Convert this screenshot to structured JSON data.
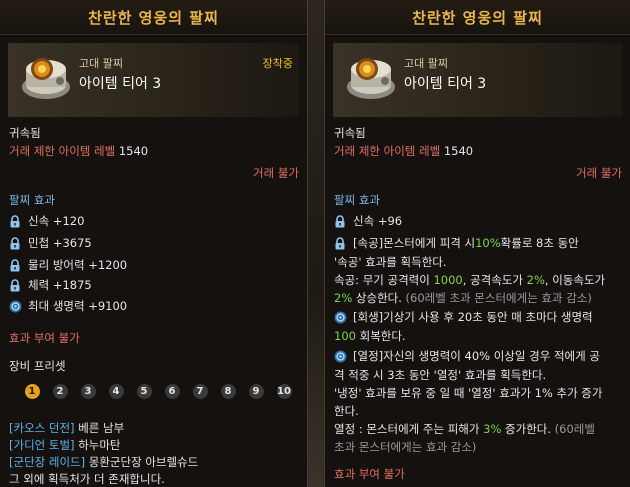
{
  "left": {
    "title": "찬란한 영웅의 팔찌",
    "grade": "고대 팔찌",
    "tier": "아이템 티어 3",
    "equipped": "장착중",
    "bound": "귀속됨",
    "level_limit_label": "거래 제한 아이템 레벨",
    "level_limit_value": "1540",
    "trade": "거래 불가",
    "effects_title": "팔찌 효과",
    "stats": [
      {
        "label": "신속 +120",
        "icon": "lock-icon"
      },
      {
        "label": "민첩 +3675",
        "icon": "lock-icon"
      },
      {
        "label": "물리 방어력 +1200",
        "icon": "lock-icon"
      },
      {
        "label": "체력 +1875",
        "icon": "lock-icon"
      },
      {
        "label": "최대 생명력 +9100",
        "icon": "swirl-icon"
      }
    ],
    "effect_grant": "효과 부여 불가",
    "preset_title": "장비 프리셋",
    "presets": [
      "1",
      "2",
      "3",
      "4",
      "5",
      "6",
      "7",
      "8",
      "9",
      "10"
    ],
    "active_preset": "1",
    "sources": [
      {
        "tag": "[카오스 던전]",
        "name": "베른 남부"
      },
      {
        "tag": "[가디언 토벌]",
        "name": "하누마탄"
      },
      {
        "tag": "[군단장 레이드]",
        "name": "몽환군단장 아브렐슈드"
      }
    ],
    "more_sources": "그 외에 획득처가 더 존재합니다."
  },
  "right": {
    "title": "찬란한 영웅의 팔찌",
    "grade": "고대 팔찌",
    "tier": "아이템 티어 3",
    "bound": "귀속됨",
    "level_limit_label": "거래 제한 아이템 레벨",
    "level_limit_value": "1540",
    "trade": "거래 불가",
    "effects_title": "팔찌 효과",
    "stat1": "신속 +96",
    "e1_tag": "[속공]",
    "e1_a": " 몬스터에게 피격 시 ",
    "e1_pct": "10%",
    "e1_b": " 확률로 8초 동안",
    "e1_c": "'속공' 효과를 획득한다.",
    "e1_d1": "속공: 무기 공격력이 ",
    "e1_n1": "1000",
    "e1_d2": ", 공격속도가 ",
    "e1_n2": "2%",
    "e1_d3": ", 이동속도가",
    "e1_n3": "2%",
    "e1_d4": " 상승한다.",
    "e1_note": " (60레벨 초과 몬스터에게는 효과 감소)",
    "e2_tag": "[회생]",
    "e2_a": " 기상기 사용 후 20초 동안 매 초마다 생명력",
    "e2_n": "100",
    "e2_b": " 회복한다.",
    "e3_tag": "[열정]",
    "e3_a": " 자신의 생명력이 40% 이상일 경우 적에게 공",
    "e3_b": "격 적중 시 3초 동안 '열정' 효과를 획득한다.",
    "e3_c": "'냉정' 효과를 보유 중 일 때 '열정' 효과가 1% 추가 증가",
    "e3_d": "한다.",
    "e3_e1": "열정 : 몬스터에게 주는 피해가 ",
    "e3_n": "3%",
    "e3_e2": " 증가한다.",
    "e3_note1": " (60레벨",
    "e3_note2": "초과 몬스터에게는 효과 감소)",
    "effect_grant": "효과 부여 불가"
  }
}
